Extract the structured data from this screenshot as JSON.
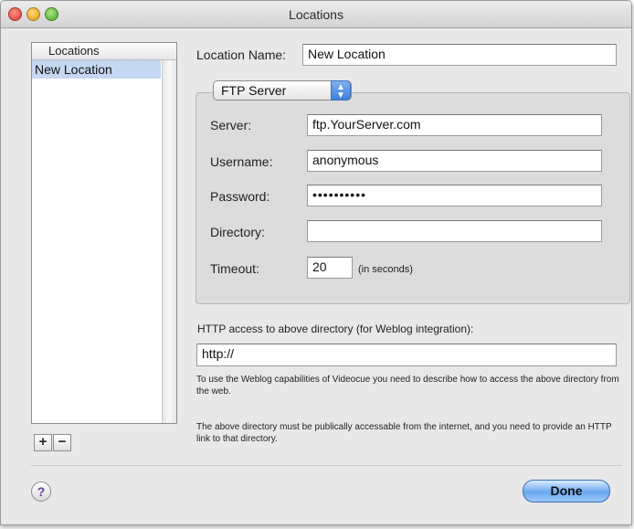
{
  "window": {
    "title": "Locations"
  },
  "sidebar": {
    "header": "Locations",
    "items": [
      "New Location"
    ],
    "add_label": "+",
    "remove_label": "−"
  },
  "location": {
    "name_label": "Location Name:",
    "name_value": "New Location"
  },
  "server_type": {
    "selected": "FTP Server"
  },
  "ftp": {
    "server_label": "Server:",
    "server_value": "ftp.YourServer.com",
    "username_label": "Username:",
    "username_value": "anonymous",
    "password_label": "Password:",
    "password_value": "••••••••••",
    "directory_label": "Directory:",
    "directory_value": "",
    "timeout_label": "Timeout:",
    "timeout_value": "20",
    "timeout_unit": "(in seconds)"
  },
  "http": {
    "label": "HTTP access to above directory (for Weblog integration):",
    "value": "http://",
    "note1": "To use the Weblog capabilities of Videocue you need to describe how to access the above directory from the web.",
    "note2": "The above directory must be publically accessable from the internet, and you need to provide an HTTP link to that directory."
  },
  "footer": {
    "help_label": "?",
    "done_label": "Done"
  }
}
